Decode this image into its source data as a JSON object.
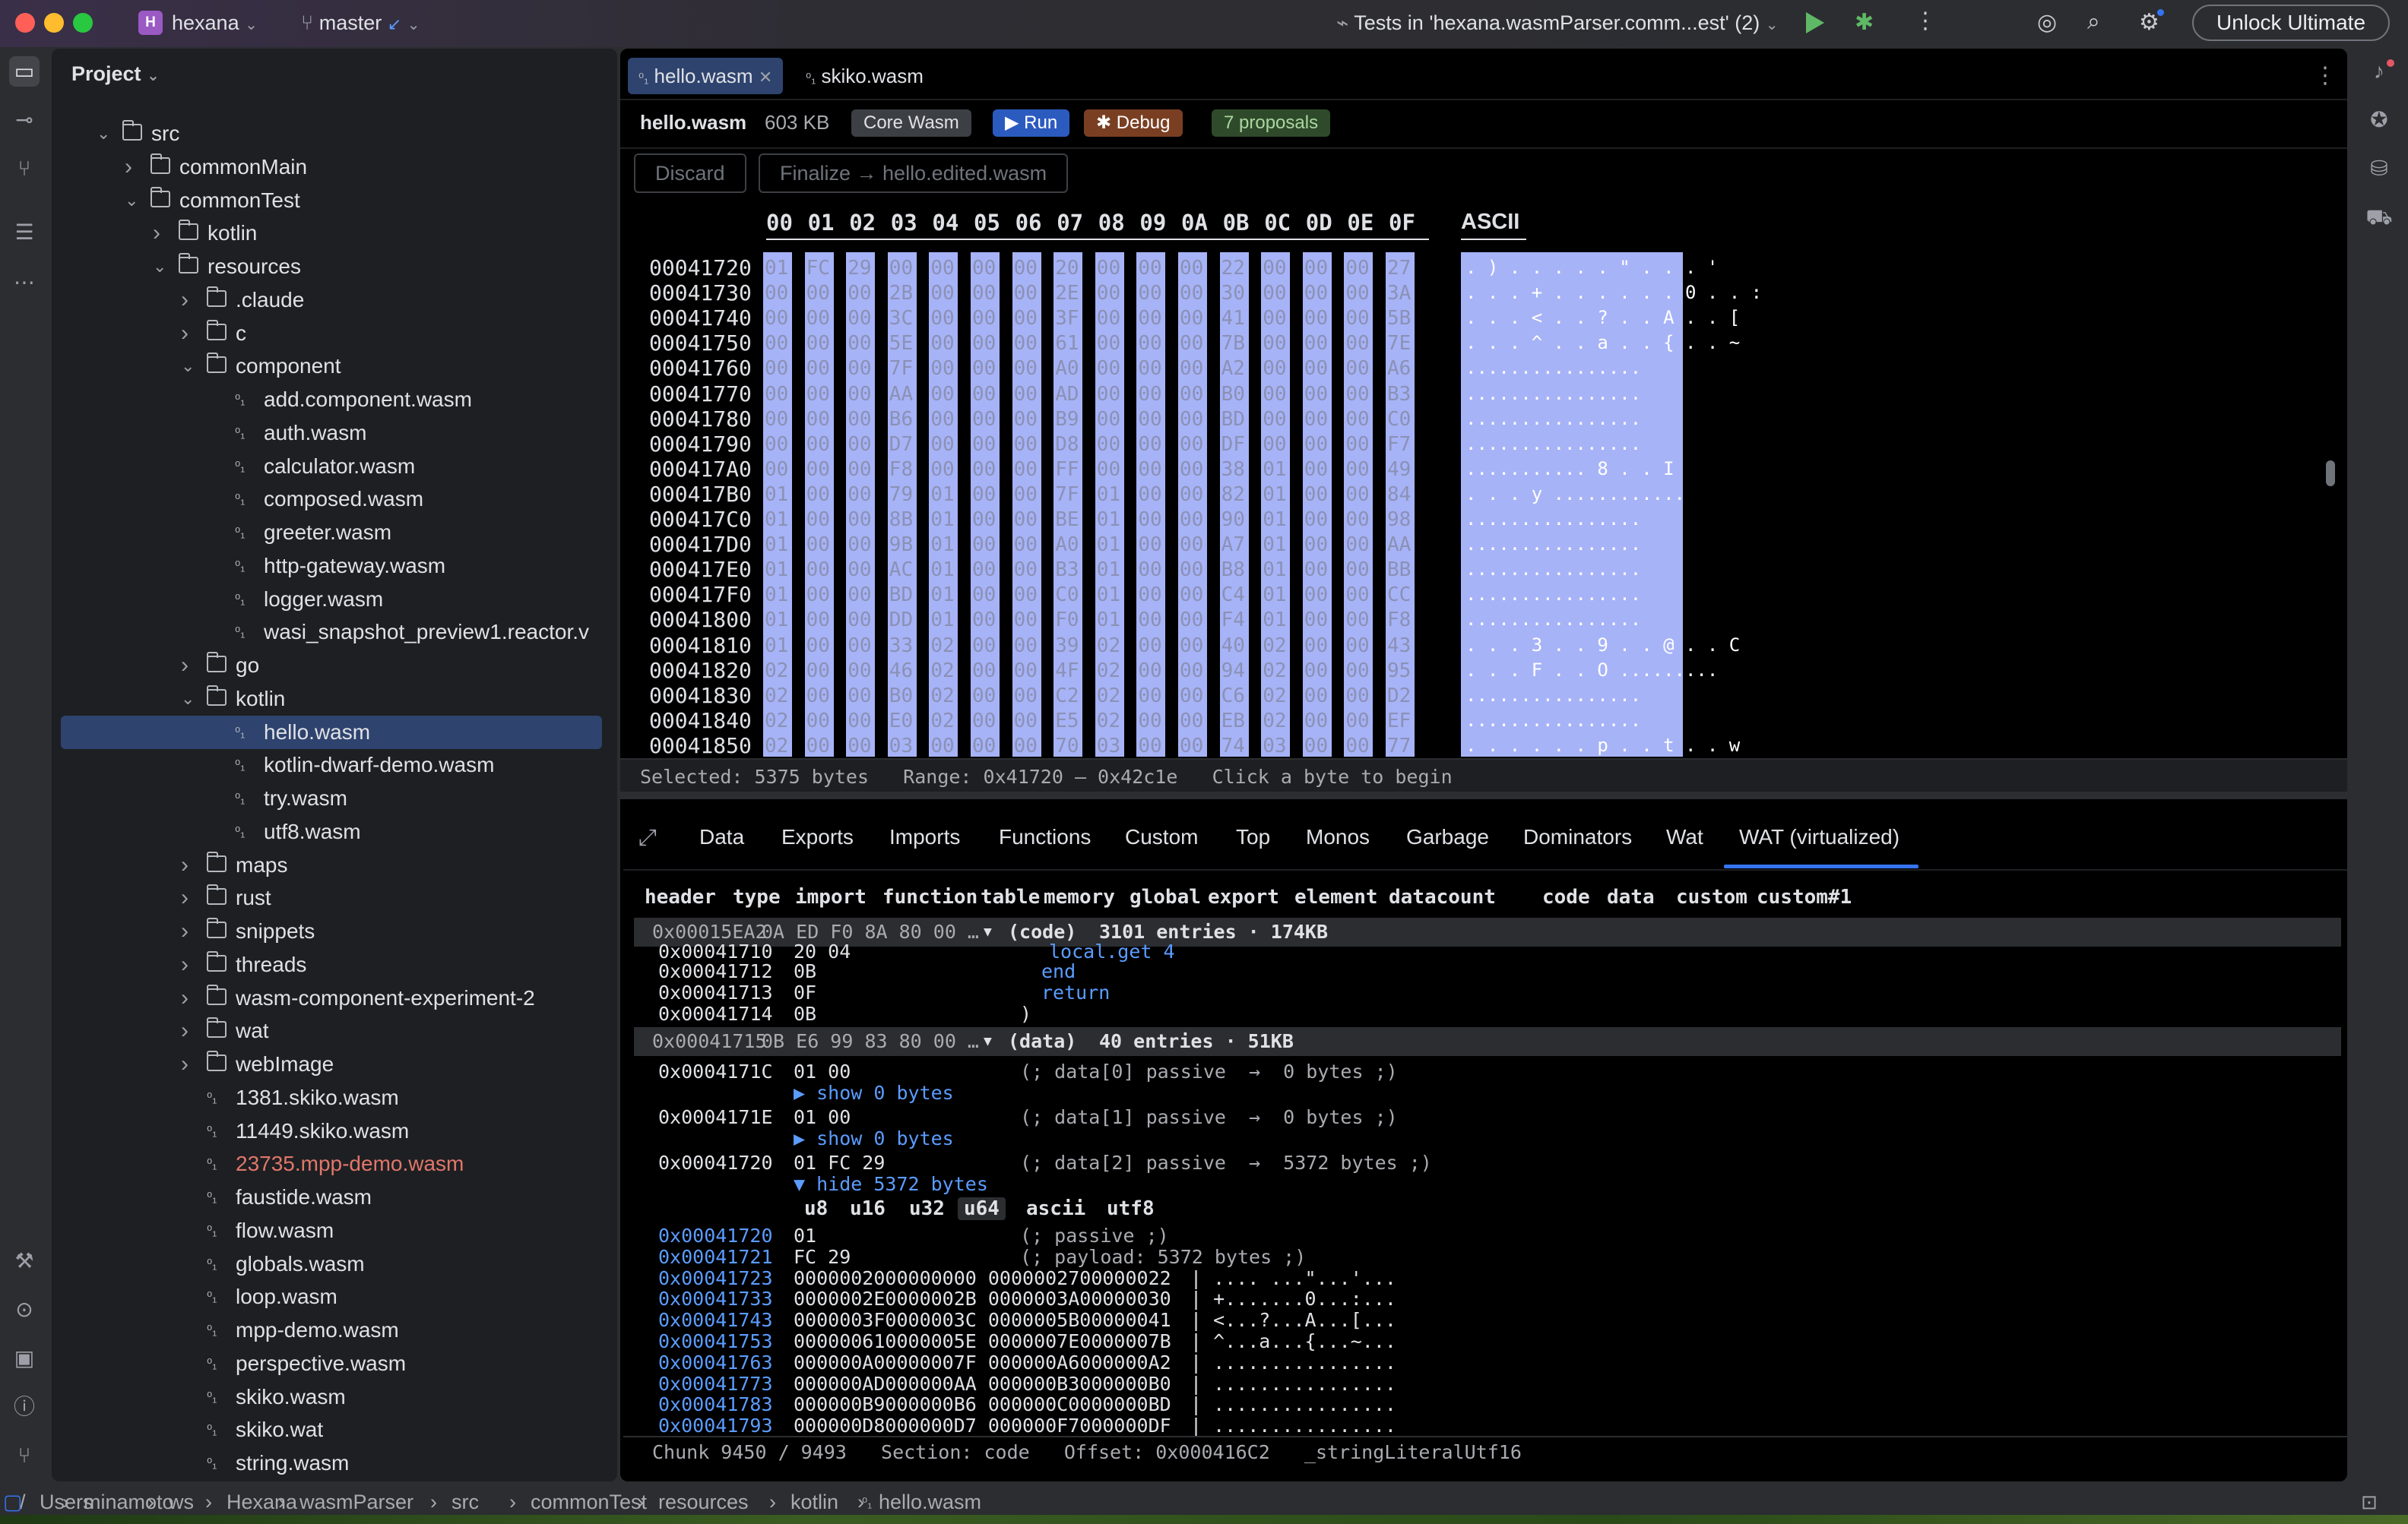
{
  "titlebar": {
    "project_badge": "H",
    "project_name": "hexana",
    "branch": "master",
    "run_config": "Tests in 'hexana.wasmParser.comm...est' (2)",
    "unlock_label": "Unlock Ultimate"
  },
  "project_panel": {
    "title": "Project",
    "tree": [
      {
        "label": "src",
        "depth": 1,
        "kind": "folder",
        "open": true
      },
      {
        "label": "commonMain",
        "depth": 2,
        "kind": "folder",
        "open": false
      },
      {
        "label": "commonTest",
        "depth": 2,
        "kind": "folder",
        "open": true
      },
      {
        "label": "kotlin",
        "depth": 3,
        "kind": "folder",
        "open": false
      },
      {
        "label": "resources",
        "depth": 3,
        "kind": "folder",
        "open": true
      },
      {
        "label": ".claude",
        "depth": 4,
        "kind": "folder",
        "open": false
      },
      {
        "label": "c",
        "depth": 4,
        "kind": "folder",
        "open": false
      },
      {
        "label": "component",
        "depth": 4,
        "kind": "folder",
        "open": true
      },
      {
        "label": "add.component.wasm",
        "depth": 5,
        "kind": "file"
      },
      {
        "label": "auth.wasm",
        "depth": 5,
        "kind": "file"
      },
      {
        "label": "calculator.wasm",
        "depth": 5,
        "kind": "file"
      },
      {
        "label": "composed.wasm",
        "depth": 5,
        "kind": "file"
      },
      {
        "label": "greeter.wasm",
        "depth": 5,
        "kind": "file"
      },
      {
        "label": "http-gateway.wasm",
        "depth": 5,
        "kind": "file"
      },
      {
        "label": "logger.wasm",
        "depth": 5,
        "kind": "file"
      },
      {
        "label": "wasi_snapshot_preview1.reactor.v",
        "depth": 5,
        "kind": "file"
      },
      {
        "label": "go",
        "depth": 4,
        "kind": "folder",
        "open": false
      },
      {
        "label": "kotlin",
        "depth": 4,
        "kind": "folder",
        "open": true
      },
      {
        "label": "hello.wasm",
        "depth": 5,
        "kind": "file",
        "selected": true
      },
      {
        "label": "kotlin-dwarf-demo.wasm",
        "depth": 5,
        "kind": "file"
      },
      {
        "label": "try.wasm",
        "depth": 5,
        "kind": "file"
      },
      {
        "label": "utf8.wasm",
        "depth": 5,
        "kind": "file"
      },
      {
        "label": "maps",
        "depth": 4,
        "kind": "folder",
        "open": false
      },
      {
        "label": "rust",
        "depth": 4,
        "kind": "folder",
        "open": false
      },
      {
        "label": "snippets",
        "depth": 4,
        "kind": "folder",
        "open": false
      },
      {
        "label": "threads",
        "depth": 4,
        "kind": "folder",
        "open": false
      },
      {
        "label": "wasm-component-experiment-2",
        "depth": 4,
        "kind": "folder",
        "open": false
      },
      {
        "label": "wat",
        "depth": 4,
        "kind": "folder",
        "open": false
      },
      {
        "label": "webImage",
        "depth": 4,
        "kind": "folder",
        "open": false
      },
      {
        "label": "1381.skiko.wasm",
        "depth": 4,
        "kind": "file"
      },
      {
        "label": "11449.skiko.wasm",
        "depth": 4,
        "kind": "file"
      },
      {
        "label": "23735.mpp-demo.wasm",
        "depth": 4,
        "kind": "file",
        "modified": true
      },
      {
        "label": "faustide.wasm",
        "depth": 4,
        "kind": "file"
      },
      {
        "label": "flow.wasm",
        "depth": 4,
        "kind": "file"
      },
      {
        "label": "globals.wasm",
        "depth": 4,
        "kind": "file"
      },
      {
        "label": "loop.wasm",
        "depth": 4,
        "kind": "file"
      },
      {
        "label": "mpp-demo.wasm",
        "depth": 4,
        "kind": "file"
      },
      {
        "label": "perspective.wasm",
        "depth": 4,
        "kind": "file"
      },
      {
        "label": "skiko.wasm",
        "depth": 4,
        "kind": "file"
      },
      {
        "label": "skiko.wat",
        "depth": 4,
        "kind": "file"
      },
      {
        "label": "string.wasm",
        "depth": 4,
        "kind": "file"
      }
    ]
  },
  "editor": {
    "tabs": [
      {
        "label": "hello.wasm",
        "active": true
      },
      {
        "label": "skiko.wasm",
        "active": false
      }
    ],
    "file_name": "hello.wasm",
    "file_size": "603 KB",
    "badge_core": "Core Wasm",
    "run_label": "Run",
    "debug_label": "Debug",
    "proposals": "7 proposals",
    "discard_label": "Discard",
    "finalize_label": "Finalize → hello.edited.wasm"
  },
  "hex": {
    "columns": [
      "00",
      "01",
      "02",
      "03",
      "04",
      "05",
      "06",
      "07",
      "08",
      "09",
      "0A",
      "0B",
      "0C",
      "0D",
      "0E",
      "0F"
    ],
    "ascii_header": "ASCII",
    "rows": [
      {
        "addr": "00041720",
        "bytes": [
          "01",
          "FC",
          "29",
          "00",
          "00",
          "00",
          "00",
          "20",
          "00",
          "00",
          "00",
          "22",
          "00",
          "00",
          "00",
          "27"
        ],
        "ascii": ". ) . . . . . \" . . . '"
      },
      {
        "addr": "00041730",
        "bytes": [
          "00",
          "00",
          "00",
          "2B",
          "00",
          "00",
          "00",
          "2E",
          "00",
          "00",
          "00",
          "30",
          "00",
          "00",
          "00",
          "3A"
        ],
        "ascii": ". . . + . . . . . . 0 . . :"
      },
      {
        "addr": "00041740",
        "bytes": [
          "00",
          "00",
          "00",
          "3C",
          "00",
          "00",
          "00",
          "3F",
          "00",
          "00",
          "00",
          "41",
          "00",
          "00",
          "00",
          "5B"
        ],
        "ascii": ". . . < . . ? . . A . . ["
      },
      {
        "addr": "00041750",
        "bytes": [
          "00",
          "00",
          "00",
          "5E",
          "00",
          "00",
          "00",
          "61",
          "00",
          "00",
          "00",
          "7B",
          "00",
          "00",
          "00",
          "7E"
        ],
        "ascii": ". . . ^ . . a . . { . . ~"
      },
      {
        "addr": "00041760",
        "bytes": [
          "00",
          "00",
          "00",
          "7F",
          "00",
          "00",
          "00",
          "A0",
          "00",
          "00",
          "00",
          "A2",
          "00",
          "00",
          "00",
          "A6"
        ],
        "ascii": "................"
      },
      {
        "addr": "00041770",
        "bytes": [
          "00",
          "00",
          "00",
          "AA",
          "00",
          "00",
          "00",
          "AD",
          "00",
          "00",
          "00",
          "B0",
          "00",
          "00",
          "00",
          "B3"
        ],
        "ascii": "................"
      },
      {
        "addr": "00041780",
        "bytes": [
          "00",
          "00",
          "00",
          "B6",
          "00",
          "00",
          "00",
          "B9",
          "00",
          "00",
          "00",
          "BD",
          "00",
          "00",
          "00",
          "C0"
        ],
        "ascii": "................"
      },
      {
        "addr": "00041790",
        "bytes": [
          "00",
          "00",
          "00",
          "D7",
          "00",
          "00",
          "00",
          "D8",
          "00",
          "00",
          "00",
          "DF",
          "00",
          "00",
          "00",
          "F7"
        ],
        "ascii": "................"
      },
      {
        "addr": "000417A0",
        "bytes": [
          "00",
          "00",
          "00",
          "F8",
          "00",
          "00",
          "00",
          "FF",
          "00",
          "00",
          "00",
          "38",
          "01",
          "00",
          "00",
          "49"
        ],
        "ascii": "........... 8 . . I"
      },
      {
        "addr": "000417B0",
        "bytes": [
          "01",
          "00",
          "00",
          "79",
          "01",
          "00",
          "00",
          "7F",
          "01",
          "00",
          "00",
          "82",
          "01",
          "00",
          "00",
          "84"
        ],
        "ascii": ". . . y ............"
      },
      {
        "addr": "000417C0",
        "bytes": [
          "01",
          "00",
          "00",
          "8B",
          "01",
          "00",
          "00",
          "BE",
          "01",
          "00",
          "00",
          "90",
          "01",
          "00",
          "00",
          "98"
        ],
        "ascii": "................"
      },
      {
        "addr": "000417D0",
        "bytes": [
          "01",
          "00",
          "00",
          "9B",
          "01",
          "00",
          "00",
          "A0",
          "01",
          "00",
          "00",
          "A7",
          "01",
          "00",
          "00",
          "AA"
        ],
        "ascii": "................"
      },
      {
        "addr": "000417E0",
        "bytes": [
          "01",
          "00",
          "00",
          "AC",
          "01",
          "00",
          "00",
          "B3",
          "01",
          "00",
          "00",
          "B8",
          "01",
          "00",
          "00",
          "BB"
        ],
        "ascii": "................"
      },
      {
        "addr": "000417F0",
        "bytes": [
          "01",
          "00",
          "00",
          "BD",
          "01",
          "00",
          "00",
          "C0",
          "01",
          "00",
          "00",
          "C4",
          "01",
          "00",
          "00",
          "CC"
        ],
        "ascii": "................"
      },
      {
        "addr": "00041800",
        "bytes": [
          "01",
          "00",
          "00",
          "DD",
          "01",
          "00",
          "00",
          "F0",
          "01",
          "00",
          "00",
          "F4",
          "01",
          "00",
          "00",
          "F8"
        ],
        "ascii": "................"
      },
      {
        "addr": "00041810",
        "bytes": [
          "01",
          "00",
          "00",
          "33",
          "02",
          "00",
          "00",
          "39",
          "02",
          "00",
          "00",
          "40",
          "02",
          "00",
          "00",
          "43"
        ],
        "ascii": ". . . 3 . . 9 . . @ . . C"
      },
      {
        "addr": "00041820",
        "bytes": [
          "02",
          "00",
          "00",
          "46",
          "02",
          "00",
          "00",
          "4F",
          "02",
          "00",
          "00",
          "94",
          "02",
          "00",
          "00",
          "95"
        ],
        "ascii": ". . . F . . O ........."
      },
      {
        "addr": "00041830",
        "bytes": [
          "02",
          "00",
          "00",
          "B0",
          "02",
          "00",
          "00",
          "C2",
          "02",
          "00",
          "00",
          "C6",
          "02",
          "00",
          "00",
          "D2"
        ],
        "ascii": "................"
      },
      {
        "addr": "00041840",
        "bytes": [
          "02",
          "00",
          "00",
          "E0",
          "02",
          "00",
          "00",
          "E5",
          "02",
          "00",
          "00",
          "EB",
          "02",
          "00",
          "00",
          "EF"
        ],
        "ascii": "................"
      },
      {
        "addr": "00041850",
        "bytes": [
          "02",
          "00",
          "00",
          "03",
          "00",
          "00",
          "00",
          "70",
          "03",
          "00",
          "00",
          "74",
          "03",
          "00",
          "00",
          "77"
        ],
        "ascii": ". . . . . . p . . t . . w"
      }
    ],
    "status": "Selected: 5375 bytes   Range: 0x41720 – 0x42c1e   Click a byte to begin"
  },
  "bottom_tabs": [
    "Data",
    "Exports",
    "Imports",
    "Functions",
    "Custom",
    "Top",
    "Monos",
    "Garbage",
    "Dominators",
    "Wat",
    "WAT (virtualized)"
  ],
  "bottom_active_tab": "WAT (virtualized)",
  "section_filters": [
    "header",
    "type",
    "import",
    "function",
    "table",
    "memory",
    "global",
    "export",
    "element",
    "datacount",
    "code",
    "data",
    "custom",
    "custom#1"
  ],
  "wat": {
    "code_section": {
      "offset": "0x00015EA2",
      "bytes": "0A ED F0 8A 80 00 …",
      "label": "(code)",
      "summary": "3101 entries · 174KB"
    },
    "code_tail": [
      {
        "addr": "0x00041710",
        "bytes": "20 04",
        "text": "local.get 4"
      },
      {
        "addr": "0x00041712",
        "bytes": "0B",
        "text": "end"
      },
      {
        "addr": "0x00041713",
        "bytes": "0F",
        "text": "return"
      },
      {
        "addr": "0x00041714",
        "bytes": "0B",
        "text": ")"
      }
    ],
    "data_section": {
      "offset": "0x00041715",
      "bytes": "0B E6 99 83 80 00 …",
      "label": "(data)",
      "summary": "40 entries · 51KB"
    },
    "data_entries": [
      {
        "addr": "0x0004171C",
        "bytes": "01 00",
        "comment": "(; data[0] passive  →  0 bytes ;)",
        "toggle": "▶ show 0 bytes"
      },
      {
        "addr": "0x0004171E",
        "bytes": "01 00",
        "comment": "(; data[1] passive  →  0 bytes ;)",
        "toggle": "▶ show 0 bytes"
      },
      {
        "addr": "0x00041720",
        "bytes": "01 FC 29",
        "comment": "(; data[2] passive  →  5372 bytes ;)",
        "toggle": "▼ hide 5372 bytes"
      }
    ],
    "view_modes": [
      "u8",
      "u16",
      "u32",
      "u64",
      "ascii",
      "utf8"
    ],
    "view_active": "u64",
    "payload_lines": [
      {
        "addr": "0x00041720",
        "hex": "01",
        "tail": "(; passive ;)"
      },
      {
        "addr": "0x00041721",
        "hex": "FC 29",
        "tail": "(; payload: 5372 bytes ;)"
      },
      {
        "addr": "0x00041723",
        "hex": "0000002000000000 0000002700000022",
        "tail": "| .... ...\"...'..."
      },
      {
        "addr": "0x00041733",
        "hex": "0000002E0000002B 0000003A00000030",
        "tail": "| +.......0...:..."
      },
      {
        "addr": "0x00041743",
        "hex": "0000003F0000003C 0000005B00000041",
        "tail": "| <...?...A...[..."
      },
      {
        "addr": "0x00041753",
        "hex": "000000610000005E 0000007E0000007B",
        "tail": "| ^...a...{...~..."
      },
      {
        "addr": "0x00041763",
        "hex": "000000A00000007F 000000A6000000A2",
        "tail": "| ................"
      },
      {
        "addr": "0x00041773",
        "hex": "000000AD000000AA 000000B3000000B0",
        "tail": "| ................"
      },
      {
        "addr": "0x00041783",
        "hex": "000000B9000000B6 000000C0000000BD",
        "tail": "| ................"
      },
      {
        "addr": "0x00041793",
        "hex": "000000D8000000D7 000000F7000000DF",
        "tail": "| ................"
      }
    ],
    "footer": "Chunk 9450 / 9493   Section: code   Offset: 0x000416C2   _stringLiteralUtf16"
  },
  "breadcrumb": [
    "/",
    "Users",
    "minamoto",
    "ws",
    "Hexana",
    "wasmParser",
    "src",
    "commonTest",
    "resources",
    "kotlin",
    "hello.wasm"
  ],
  "colors": {
    "accent": "#3574f0",
    "selection": "#a7b3f7",
    "debug": "#7a3f22",
    "proposals": "#2f4a2b"
  }
}
